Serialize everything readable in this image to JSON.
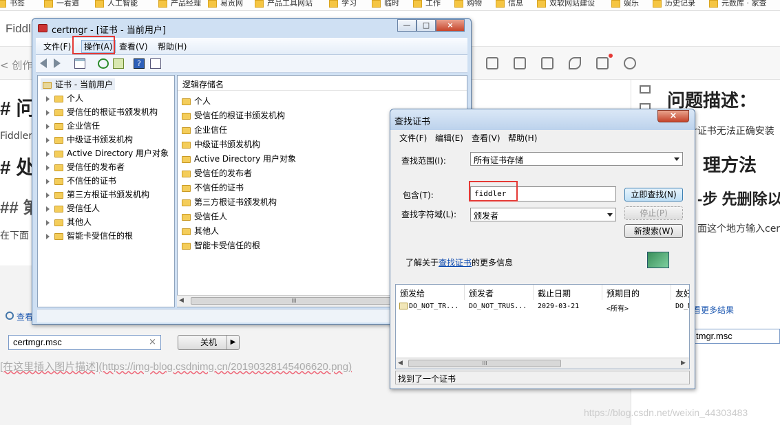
{
  "browser": {
    "bookmarks": [
      "书签",
      "一看道",
      "人工智能",
      "产品经理",
      "易贡网",
      "产品工具网站",
      "学习",
      "临时",
      "工作",
      "购物",
      "信息",
      "双软网站建设",
      "娱乐",
      "历史记录",
      "元数库 · 家查"
    ],
    "tab_title": "Fiddl",
    "back_label": "< 创作"
  },
  "editor": {
    "left_headings": [
      "# 问",
      "Fiddler",
      "# 处",
      "## 第",
      "在下面"
    ],
    "right_heading_1": "问题描述：",
    "right_text_1": "r证书无法正确安装",
    "right_heading_2": "理方法",
    "right_heading_3": "-步 先删除以",
    "right_text_2": "面这个地方输入cer",
    "image_markdown": "[在这里插入图片描述](https://img-blog.csdnimg.cn/20190328145406620.png)",
    "watermark": "https://blog.csdn.net/weixin_44303483"
  },
  "start_menu": {
    "search_link": "查看",
    "run_value": "certmgr.msc",
    "clear_icon": "×",
    "shutdown_label": "关机",
    "more_results": "看更多结果",
    "right_run_value": "tmgr.msc"
  },
  "certmgr": {
    "title": "certmgr - [证书 - 当前用户]",
    "controls": {
      "minimize": "—",
      "maximize": "□",
      "close": "×"
    },
    "menu": [
      {
        "label": "文件(F)"
      },
      {
        "label": "操作(A)",
        "highlighted": true
      },
      {
        "label": "查看(V)"
      },
      {
        "label": "帮助(H)"
      }
    ],
    "tree_root": "证书 - 当前用户",
    "tree_items": [
      "个人",
      "受信任的根证书颁发机构",
      "企业信任",
      "中级证书颁发机构",
      "Active Directory 用户对象",
      "受信任的发布者",
      "不信任的证书",
      "第三方根证书颁发机构",
      "受信任人",
      "其他人",
      "智能卡受信任的根"
    ],
    "list_header": "逻辑存储名",
    "list_items": [
      "个人",
      "受信任的根证书颁发机构",
      "企业信任",
      "中级证书颁发机构",
      "Active Directory 用户对象",
      "受信任的发布者",
      "不信任的证书",
      "第三方根证书颁发机构",
      "受信任人",
      "其他人",
      "智能卡受信任的根"
    ],
    "scroll_grip": "III"
  },
  "find_dialog": {
    "title": "查找证书",
    "close": "×",
    "menu": [
      "文件(F)",
      "编辑(E)",
      "查看(V)",
      "帮助(H)"
    ],
    "scope_label": "查找范围(I):",
    "scope_value": "所有证书存储",
    "contains_label": "包含(T):",
    "contains_value": "fiddler",
    "field_label": "查找字符域(L):",
    "field_value": "颁发者",
    "find_now": "立即查找(N)",
    "stop": "停止(P)",
    "new_search": "新搜索(W)",
    "info_prefix": "了解关于",
    "info_link": "查找证书",
    "info_suffix": "的更多信息",
    "columns": [
      "颁发给",
      "颁发者",
      "截止日期",
      "预期目的",
      "友好"
    ],
    "result_row": [
      "DO_NOT_TR...",
      "DO_NOT_TRUS...",
      "2029-03-21",
      "<所有>",
      "DO_N"
    ],
    "status": "找到了一个证书",
    "scroll_grip": "III"
  },
  "colors": {
    "highlight": "#e53935",
    "link": "#0645ad"
  }
}
